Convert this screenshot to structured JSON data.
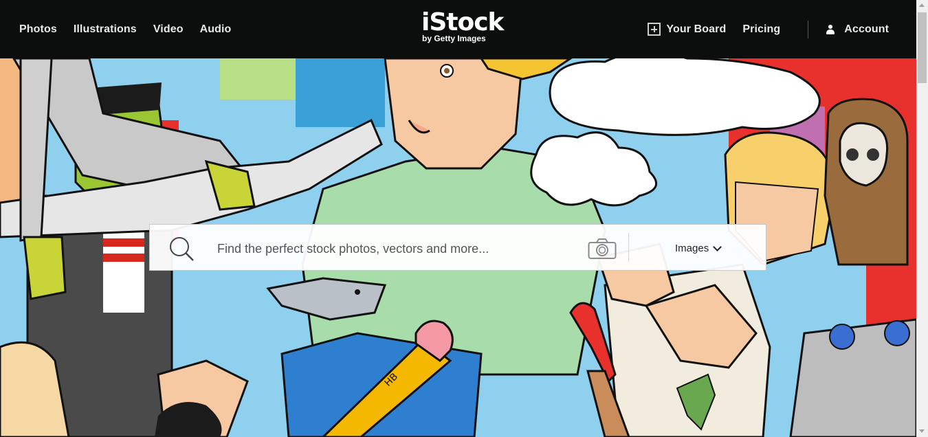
{
  "nav": {
    "left_links": [
      "Photos",
      "Illustrations",
      "Video",
      "Audio"
    ],
    "logo_main": "iStock",
    "logo_sub": "by Getty Images",
    "your_board": "Your Board",
    "pricing": "Pricing",
    "account": "Account"
  },
  "search": {
    "placeholder": "Find the perfect stock photos, vectors and more...",
    "media_type": "Images"
  },
  "hero": {
    "pencil_label": "HB"
  },
  "colors": {
    "header_bg": "#0c0d0d",
    "hero_sky": "#8fd0ee"
  }
}
